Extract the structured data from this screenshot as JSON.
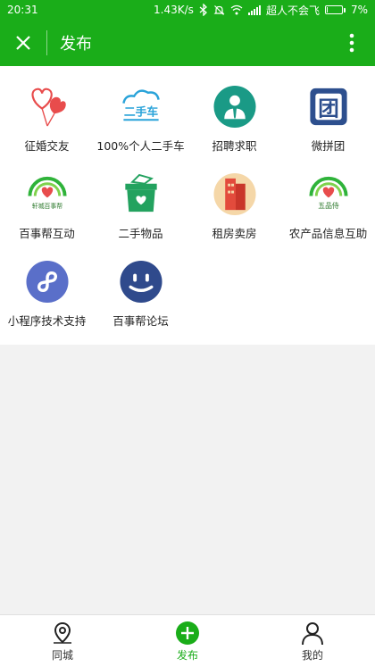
{
  "status_bar": {
    "time": "20:31",
    "network_speed": "1.43K/s",
    "carrier": "超人不会飞",
    "battery": "7%",
    "battery_level": 0.07
  },
  "header": {
    "title": "发布"
  },
  "grid": {
    "items": [
      {
        "label": "征婚交友",
        "icon": "heart-balloon-icon"
      },
      {
        "label": "100%个人二手车",
        "icon": "used-car-cloud-icon"
      },
      {
        "label": "招聘求职",
        "icon": "job-person-icon"
      },
      {
        "label": "微拼团",
        "icon": "group-buy-icon"
      },
      {
        "label": "百事帮互动",
        "icon": "community-heart-icon"
      },
      {
        "label": "二手物品",
        "icon": "second-hand-box-icon"
      },
      {
        "label": "租房卖房",
        "icon": "building-icon"
      },
      {
        "label": "农产品信息互助",
        "icon": "farm-heart-icon"
      },
      {
        "label": "小程序技术支持",
        "icon": "mini-program-icon"
      },
      {
        "label": "百事帮论坛",
        "icon": "smiley-icon"
      }
    ],
    "icon_text": {
      "used_car": "二手车",
      "group_buy": "团",
      "community": "轩城百事帮",
      "farm": "五品侍"
    }
  },
  "tabbar": {
    "tabs": [
      {
        "label": "同城",
        "icon": "location-pin-icon",
        "active": false
      },
      {
        "label": "发布",
        "icon": "plus-circle-icon",
        "active": true
      },
      {
        "label": "我的",
        "icon": "person-icon",
        "active": false
      }
    ]
  },
  "colors": {
    "primary": "#1aad19",
    "background": "#f2f2f2"
  }
}
